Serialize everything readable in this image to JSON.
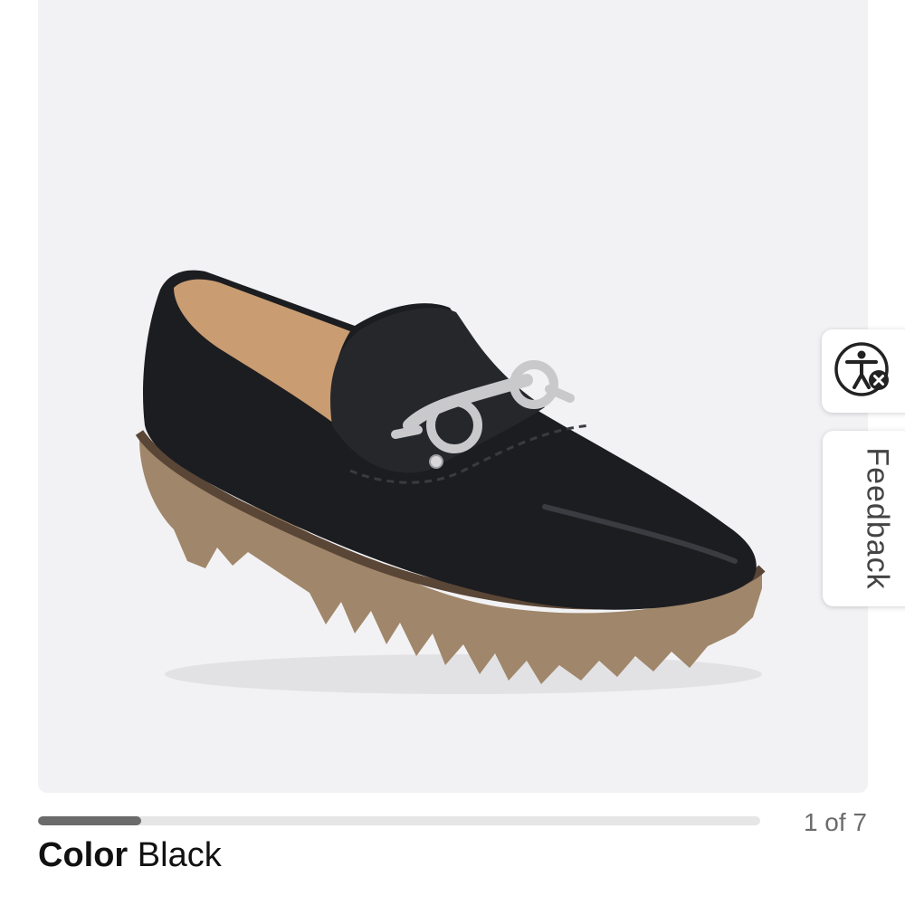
{
  "gallery": {
    "image_alt": "Black loafer with silver horsebit hardware and lug sole",
    "current_index": 1,
    "total": 7,
    "counter_text": "1 of 7",
    "progress_fraction": 0.143
  },
  "color": {
    "label": "Color",
    "value": "Black"
  },
  "side_widgets": {
    "accessibility_icon": "accessibility-icon",
    "feedback_label": "Feedback"
  },
  "colors": {
    "gallery_bg": "#f2f2f4",
    "progress_track": "#e6e6e6",
    "progress_fill": "#6b6b6b",
    "text_primary": "#111111",
    "text_muted": "#6b6b6b"
  }
}
